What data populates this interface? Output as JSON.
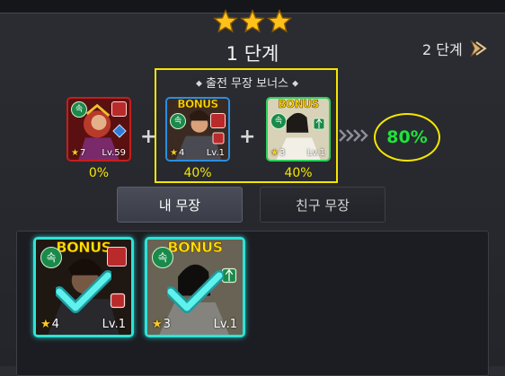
{
  "header": {
    "stars_filled": 3,
    "stage_title": "1 단계",
    "next_stage_label": "2 단계"
  },
  "bonus_section": {
    "title": "출전 무장 보너스",
    "total_bonus": "80%"
  },
  "slots": [
    {
      "bonus_label": "",
      "star": "7",
      "level": "Lv.59",
      "percent": "0%",
      "attribute_badge": "속"
    },
    {
      "bonus_label": "BONUS",
      "star": "4",
      "level": "Lv.1",
      "percent": "40%",
      "attribute_badge": "속"
    },
    {
      "bonus_label": "BONUS",
      "star": "3",
      "level": "Lv.1",
      "percent": "40%",
      "attribute_badge": "속"
    }
  ],
  "tabs": {
    "my_heroes": "내 무장",
    "friend_heroes": "친구 무장"
  },
  "hero_list": [
    {
      "bonus_label": "BONUS",
      "star": "4",
      "level": "Lv.1",
      "attribute_badge": "속",
      "selected": true
    },
    {
      "bonus_label": "BONUS",
      "star": "3",
      "level": "Lv.1",
      "attribute_badge": "속",
      "selected": true
    }
  ],
  "colors": {
    "highlight_yellow": "#f5e600",
    "total_green": "#1ee33a",
    "selected_cyan": "#2de3d7",
    "bonus_gold": "#ffe200"
  },
  "icons": [
    "star-icon",
    "chevron-right-icon",
    "check-icon",
    "attribute-icon",
    "class-icon",
    "stat-icon"
  ]
}
